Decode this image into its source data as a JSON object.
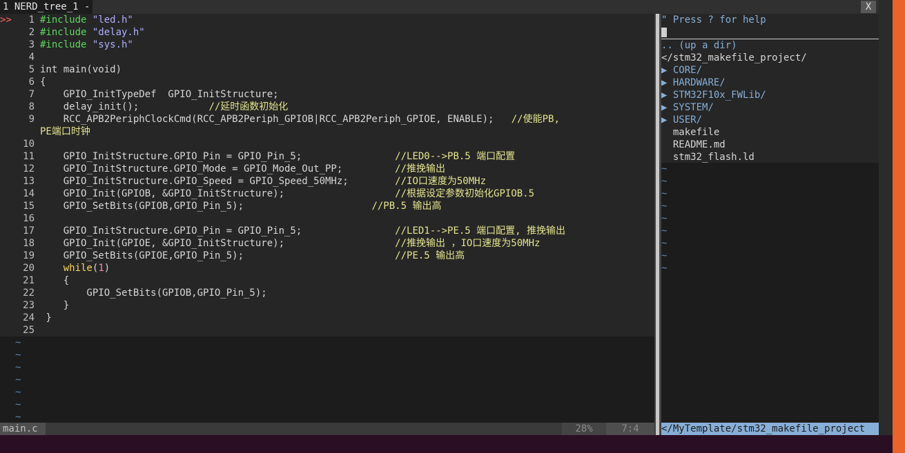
{
  "tabline": {
    "tab_label": "1 NERD_tree_1 -",
    "close_label": "X"
  },
  "editor": {
    "marker": ">>",
    "lines": [
      {
        "n": "1",
        "segs": [
          {
            "t": "#include ",
            "c": "pp"
          },
          {
            "t": "\"led.h\"",
            "c": "str"
          }
        ]
      },
      {
        "n": "2",
        "segs": [
          {
            "t": "#include ",
            "c": "pp"
          },
          {
            "t": "\"delay.h\"",
            "c": "str"
          }
        ]
      },
      {
        "n": "3",
        "segs": [
          {
            "t": "#include ",
            "c": "pp"
          },
          {
            "t": "\"sys.h\"",
            "c": "str"
          }
        ]
      },
      {
        "n": "4",
        "segs": []
      },
      {
        "n": "5",
        "segs": [
          {
            "t": "int main(void)",
            "c": ""
          }
        ]
      },
      {
        "n": "6",
        "segs": [
          {
            "t": "{",
            "c": ""
          }
        ]
      },
      {
        "n": "7",
        "segs": [
          {
            "t": "    GPIO_InitTypeDef  GPIO_InitStructure;",
            "c": ""
          }
        ]
      },
      {
        "n": "8",
        "segs": [
          {
            "t": "    delay_init();            ",
            "c": ""
          },
          {
            "t": "//延时函数初始化",
            "c": "cm"
          }
        ]
      },
      {
        "n": "9",
        "segs": [
          {
            "t": "    RCC_APB2PeriphClockCmd(RCC_APB2Periph_GPIOB|RCC_APB2Periph_GPIOE, ENABLE);   ",
            "c": ""
          },
          {
            "t": "//使能PB,",
            "c": "cm"
          }
        ]
      },
      {
        "n": "",
        "segs": [
          {
            "t": "PE端口时钟",
            "c": "cm"
          }
        ]
      },
      {
        "n": "10",
        "segs": []
      },
      {
        "n": "11",
        "segs": [
          {
            "t": "    GPIO_InitStructure.GPIO_Pin = GPIO_Pin_5;                ",
            "c": ""
          },
          {
            "t": "//LED0-->PB.5 端口配置",
            "c": "cm"
          }
        ]
      },
      {
        "n": "12",
        "segs": [
          {
            "t": "    GPIO_InitStructure.GPIO_Mode = GPIO_Mode_Out_PP;         ",
            "c": ""
          },
          {
            "t": "//推挽输出",
            "c": "cm"
          }
        ]
      },
      {
        "n": "13",
        "segs": [
          {
            "t": "    GPIO_InitStructure.GPIO_Speed = GPIO_Speed_50MHz;        ",
            "c": ""
          },
          {
            "t": "//IO口速度为50MHz",
            "c": "cm"
          }
        ]
      },
      {
        "n": "14",
        "segs": [
          {
            "t": "    GPIO_Init(GPIOB, &GPIO_InitStructure);                   ",
            "c": ""
          },
          {
            "t": "//根据设定参数初始化GPIOB.5",
            "c": "cm"
          }
        ]
      },
      {
        "n": "15",
        "segs": [
          {
            "t": "    GPIO_SetBits(GPIOB,GPIO_Pin_5);                      ",
            "c": ""
          },
          {
            "t": "//PB.5 输出高",
            "c": "cm"
          }
        ]
      },
      {
        "n": "16",
        "segs": []
      },
      {
        "n": "17",
        "segs": [
          {
            "t": "    GPIO_InitStructure.GPIO_Pin = GPIO_Pin_5;                ",
            "c": ""
          },
          {
            "t": "//LED1-->PE.5 端口配置, 推挽输出",
            "c": "cm"
          }
        ]
      },
      {
        "n": "18",
        "segs": [
          {
            "t": "    GPIO_Init(GPIOE, &GPIO_InitStructure);                   ",
            "c": ""
          },
          {
            "t": "//推挽输出 ，IO口速度为50MHz",
            "c": "cm"
          }
        ]
      },
      {
        "n": "19",
        "segs": [
          {
            "t": "    GPIO_SetBits(GPIOE,GPIO_Pin_5);                          ",
            "c": ""
          },
          {
            "t": "//PE.5 输出高",
            "c": "cm"
          }
        ]
      },
      {
        "n": "20",
        "segs": [
          {
            "t": "    ",
            "c": ""
          },
          {
            "t": "while",
            "c": "kw"
          },
          {
            "t": "(",
            "c": ""
          },
          {
            "t": "1",
            "c": "num"
          },
          {
            "t": ")",
            "c": ""
          }
        ]
      },
      {
        "n": "21",
        "segs": [
          {
            "t": "    {",
            "c": ""
          }
        ]
      },
      {
        "n": "22",
        "segs": [
          {
            "t": "        GPIO_SetBits(GPIOB,GPIO_Pin_5);",
            "c": ""
          }
        ]
      },
      {
        "n": "23",
        "segs": [
          {
            "t": "    }",
            "c": ""
          }
        ]
      },
      {
        "n": "24",
        "segs": [
          {
            "t": " }",
            "c": ""
          }
        ]
      },
      {
        "n": "25",
        "segs": []
      }
    ],
    "tilde_count": 7
  },
  "tree": {
    "help": "\" Press ? for help",
    "up": ".. (up a dir)",
    "root": "</stm32_makefile_project/",
    "dirs": [
      {
        "arrow": "▶",
        "name": "CORE/"
      },
      {
        "arrow": "▶",
        "name": "HARDWARE/"
      },
      {
        "arrow": "▶",
        "name": "STM32F10x_FWLib/"
      },
      {
        "arrow": "▶",
        "name": "SYSTEM/"
      },
      {
        "arrow": "▶",
        "name": "USER/"
      }
    ],
    "files": [
      "makefile",
      "README.md",
      "stm32_flash.ld"
    ],
    "tilde_count": 21
  },
  "status": {
    "file": "main.c",
    "percent": "28%",
    "position": "7:4",
    "tree_path": "</MyTemplate/stm32_makefile_project"
  }
}
